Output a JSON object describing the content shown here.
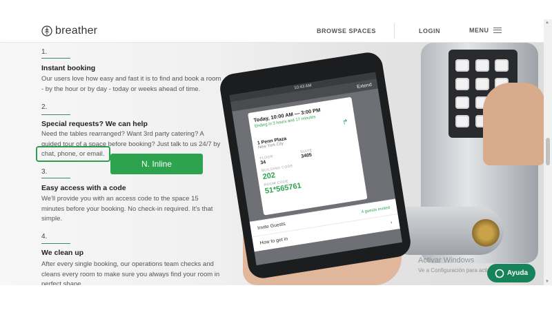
{
  "header": {
    "logo_text": "breather",
    "nav": {
      "browse": "BROWSE SPACES",
      "login": "LOGIN",
      "menu": "MENU"
    }
  },
  "steps": [
    {
      "num": "1.",
      "title": "Instant booking",
      "body": "Our users love how easy and fast it is to find and book a room - by the hour or by day - today or weeks ahead of time."
    },
    {
      "num": "2.",
      "title": "Special requests? We can help",
      "body": "Need the tables rearranged? Want 3rd party catering? A guided tour of a space before booking? Just talk to us 24/7 by chat, phone, or email."
    },
    {
      "num": "3.",
      "title": "Easy access with a code",
      "body": "We'll provide you with an access code to the space 15 minutes before your booking. No check-in required. It's that simple."
    },
    {
      "num": "4.",
      "title": "We clean up",
      "body": "After every single booking, our operations team checks and cleans every room to make sure you always find your room in perfect shape."
    }
  ],
  "annotation": {
    "label": "N. Inline"
  },
  "phone": {
    "status_time": "10:43 AM",
    "extend": "Extend",
    "when": "Today, 10:00 AM — 3:00 PM",
    "ending": "Ending in 3 hours and 17 minutes",
    "address": "1 Penn Plaza",
    "city": "New York City",
    "floor_label": "FLOOR",
    "floor": "34",
    "suite_label": "SUITE",
    "suite": "3405",
    "building_label": "BUILDING CODE",
    "building_code": "202",
    "room_label": "ROOM CODE",
    "room_code": "51*565761",
    "invite": "Invite Guests",
    "invited": "4 guests invited",
    "howto": "How to get in"
  },
  "watermark": {
    "line1": "Activar Windows",
    "line2": "Ve a Configuración para activar Windows."
  },
  "help": {
    "label": "Ayuda"
  },
  "colors": {
    "accent": "#2ea34f",
    "help": "#17835a"
  }
}
